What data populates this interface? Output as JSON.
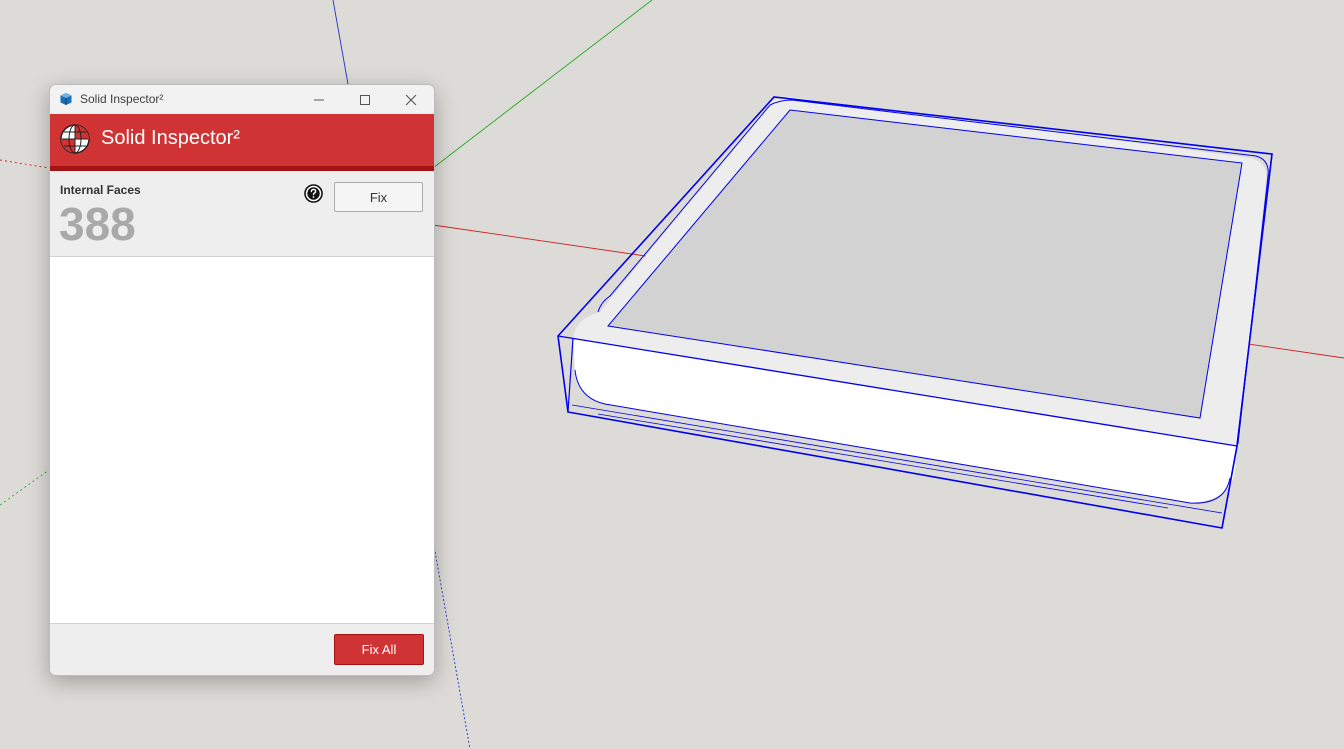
{
  "window": {
    "title": "Solid Inspector²",
    "controls": {
      "minimize_icon": "minimize-icon",
      "maximize_icon": "maximize-icon",
      "close_icon": "close-icon"
    }
  },
  "header": {
    "title": "Solid Inspector²",
    "logo_icon": "globe-logo-icon",
    "color": "#d03334"
  },
  "issue": {
    "label": "Internal Faces",
    "count": "388",
    "help_icon": "help-icon",
    "fix_label": "Fix"
  },
  "footer": {
    "fix_all_label": "Fix All"
  },
  "colors": {
    "accent": "#d03334",
    "accent_dark": "#a41414",
    "selection": "#0000ee",
    "axis_red": "#cc2222",
    "axis_green": "#22aa22",
    "axis_blue": "#2233cc",
    "canvas_bg": "#dddbd7"
  }
}
